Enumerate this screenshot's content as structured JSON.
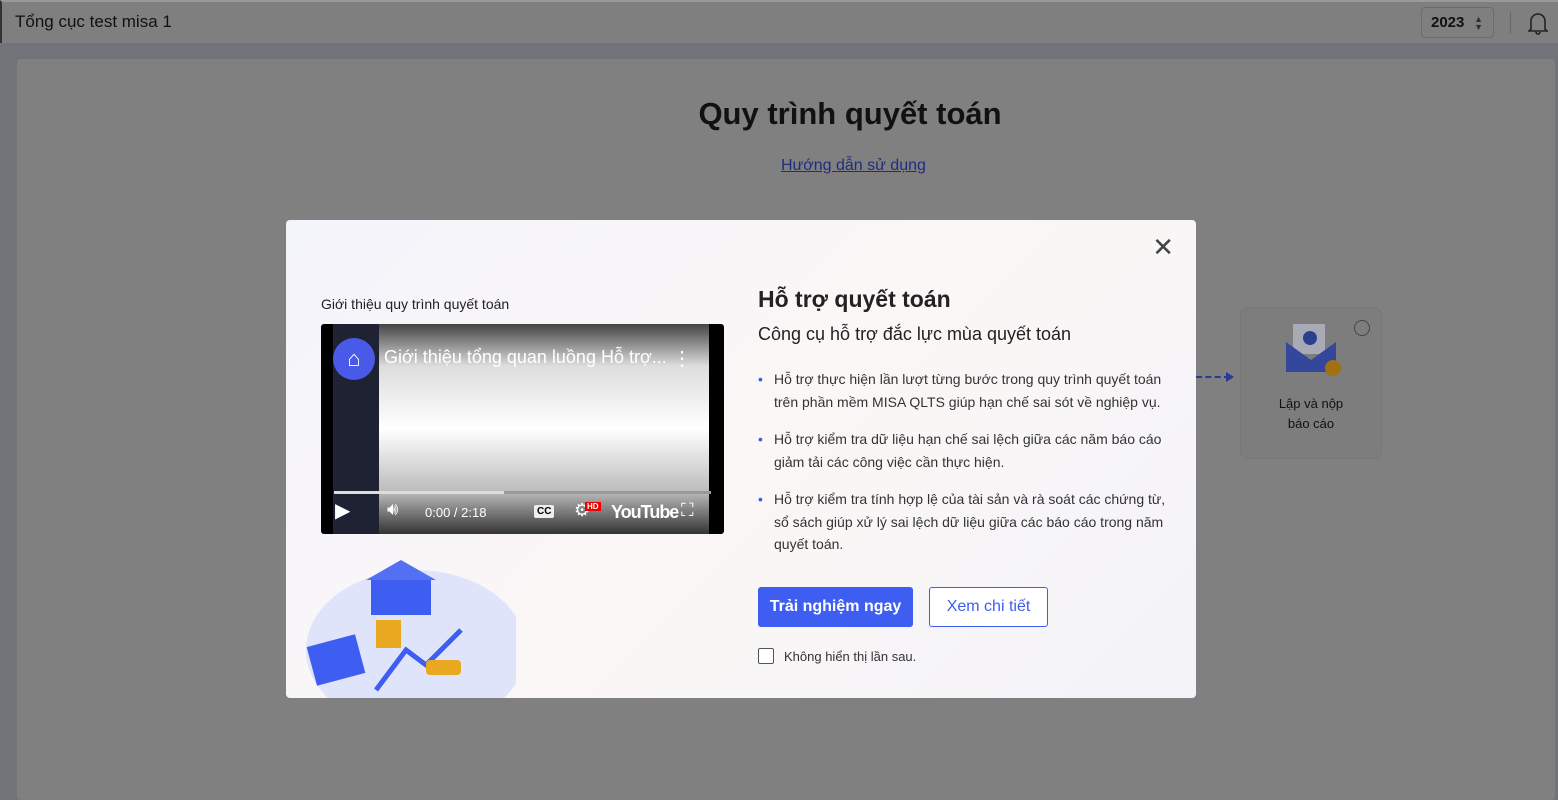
{
  "header": {
    "title": "Tổng cục test misa 1",
    "year": "2023"
  },
  "page": {
    "title": "Quy trình quyết toán",
    "guide_link": "Hướng dẫn sử dụng",
    "step": {
      "label_line1": "Lập và nộp",
      "label_line2": "báo cáo"
    }
  },
  "modal": {
    "video_label": "Giới thiệu quy trình quyết toán",
    "video": {
      "title": "Giới thiệu tổng quan luồng Hỗ trợ...",
      "time": "0:00 / 2:18",
      "brand": "YouTube",
      "cc": "CC",
      "hd": "HD",
      "progress": 0.45
    },
    "heading": "Hỗ trợ quyết toán",
    "subheading": "Công cụ hỗ trợ đắc lực mùa quyết toán",
    "bullets": [
      "Hỗ trợ thực hiện lần lượt từng bước trong quy trình quyết toán trên phần mềm MISA QLTS giúp hạn chế sai sót về nghiệp vụ.",
      "Hỗ trợ kiểm tra dữ liệu hạn chế sai lệch giữa các năm báo cáo giảm tải các công việc cần thực hiện.",
      "Hỗ trợ kiểm tra tính hợp lệ của tài sản và rà soát các chứng từ, sổ sách giúp xử lý sai lệch dữ liệu giữa các báo cáo trong năm quyết toán."
    ],
    "primary_button": "Trải nghiệm ngay",
    "secondary_button": "Xem chi tiết",
    "checkbox_label": "Không hiển thị lần sau."
  }
}
